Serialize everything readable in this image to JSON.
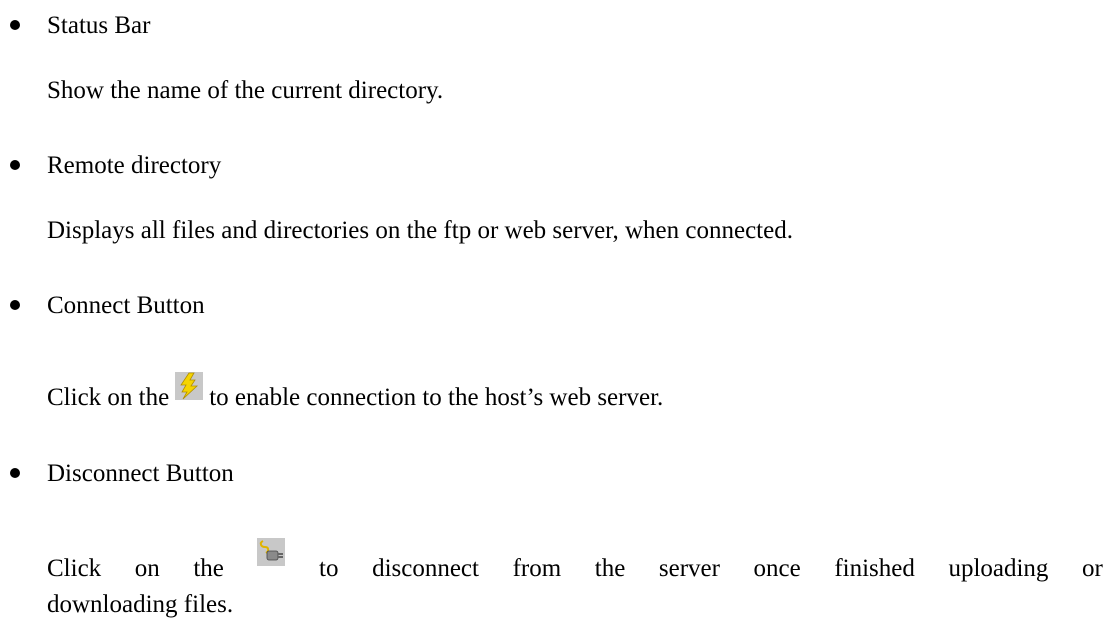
{
  "items": [
    {
      "title": "Status Bar",
      "description": "Show the name of the current directory."
    },
    {
      "title": "Remote directory",
      "description": "Displays all files and directories on the ftp or web server, when connected."
    },
    {
      "title": "Connect Button",
      "desc_before": "Click on the",
      "desc_after": "to enable connection to the host’s web server.",
      "icon": "lightning-bolt-icon",
      "icon_color": "#f5d400"
    },
    {
      "title": "Disconnect Button",
      "desc_words": [
        "Click",
        "on",
        "the"
      ],
      "desc_after_words": [
        "to",
        "disconnect",
        "from",
        "the",
        "server",
        "once",
        "finished",
        "uploading",
        "or"
      ],
      "desc_line2": "downloading files.",
      "icon": "disconnect-plug-icon"
    }
  ],
  "bullet": "•"
}
